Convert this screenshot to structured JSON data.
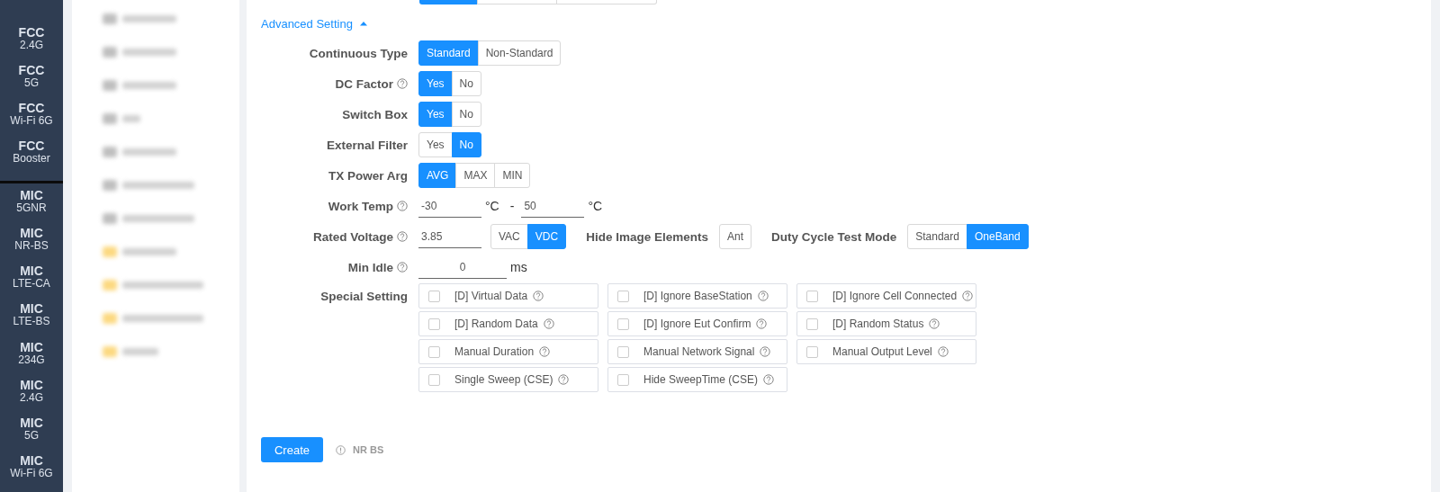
{
  "sidebar": {
    "groups": [
      {
        "items": [
          {
            "label": "FCC",
            "sub": "2.4G"
          },
          {
            "label": "FCC",
            "sub": "5G"
          },
          {
            "label": "FCC",
            "sub": "Wi-Fi 6G"
          },
          {
            "label": "FCC",
            "sub": "Booster"
          }
        ]
      },
      {
        "items": [
          {
            "label": "MIC",
            "sub": "5GNR"
          },
          {
            "label": "MIC",
            "sub": "NR-BS"
          },
          {
            "label": "MIC",
            "sub": "LTE-CA"
          },
          {
            "label": "MIC",
            "sub": "LTE-BS"
          },
          {
            "label": "MIC",
            "sub": "234G"
          },
          {
            "label": "MIC",
            "sub": "2.4G"
          },
          {
            "label": "MIC",
            "sub": "5G"
          },
          {
            "label": "MIC",
            "sub": "Wi-Fi 6G"
          }
        ]
      }
    ]
  },
  "file_list": {
    "items": [
      {
        "kind": "file"
      },
      {
        "kind": "file"
      },
      {
        "kind": "file"
      },
      {
        "kind": "file"
      },
      {
        "kind": "file"
      },
      {
        "kind": "file"
      },
      {
        "kind": "file"
      },
      {
        "kind": "folder"
      },
      {
        "kind": "folder"
      },
      {
        "kind": "folder"
      },
      {
        "kind": "folder"
      }
    ]
  },
  "form": {
    "advanced_toggle": {
      "label": "Advanced Setting",
      "expanded": true
    },
    "rows": [
      {
        "kind": "segmented",
        "label": "Continuous Type",
        "help": false,
        "options": [
          {
            "label": "Standard",
            "selected": true
          },
          {
            "label": "Non-Standard",
            "selected": false
          }
        ]
      },
      {
        "kind": "segmented",
        "label": "DC Factor",
        "help": true,
        "options": [
          {
            "label": "Yes",
            "selected": true
          },
          {
            "label": "No",
            "selected": false
          }
        ]
      },
      {
        "kind": "segmented",
        "label": "Switch Box",
        "help": false,
        "options": [
          {
            "label": "Yes",
            "selected": true
          },
          {
            "label": "No",
            "selected": false
          }
        ]
      },
      {
        "kind": "segmented",
        "label": "External Filter",
        "help": false,
        "options": [
          {
            "label": "Yes",
            "selected": false
          },
          {
            "label": "No",
            "selected": true
          }
        ]
      },
      {
        "kind": "segmented",
        "label": "TX Power Arg",
        "help": false,
        "options": [
          {
            "label": "AVG",
            "selected": true
          },
          {
            "label": "MAX",
            "selected": false
          },
          {
            "label": "MIN",
            "selected": false
          }
        ]
      },
      {
        "kind": "range",
        "label": "Work Temp",
        "help": true,
        "from": "-30",
        "from_unit": "°C",
        "separator": "-",
        "to": "50",
        "to_unit": "°C"
      },
      {
        "kind": "voltage",
        "label": "Rated Voltage",
        "help": true,
        "value": "3.85",
        "options": [
          {
            "label": "VAC",
            "selected": false
          },
          {
            "label": "VDC",
            "selected": true
          }
        ],
        "hide_label": "Hide Image Elements",
        "hide_options": [
          {
            "label": "Ant",
            "selected": false
          }
        ],
        "duty_label": "Duty Cycle Test Mode",
        "duty_options": [
          {
            "label": "Standard",
            "selected": false
          },
          {
            "label": "OneBand",
            "selected": true
          }
        ]
      },
      {
        "kind": "number",
        "label": "Min Idle",
        "help": true,
        "value": "0",
        "unit": "ms"
      }
    ],
    "special": {
      "label": "Special Setting",
      "options": [
        {
          "label": "[D] Virtual Data",
          "checked": false
        },
        {
          "label": "[D] Ignore BaseStation",
          "checked": false
        },
        {
          "label": "[D] Ignore Cell Connected",
          "checked": false
        },
        {
          "label": "[D] Random Data",
          "checked": false
        },
        {
          "label": "[D] Ignore Eut Confirm",
          "checked": false
        },
        {
          "label": "[D] Random Status",
          "checked": false
        },
        {
          "label": "Manual Duration",
          "checked": false
        },
        {
          "label": "Manual Network Signal",
          "checked": false
        },
        {
          "label": "Manual Output Level",
          "checked": false
        },
        {
          "label": "Single Sweep (CSE)",
          "checked": false
        },
        {
          "label": "Hide SweepTime (CSE)",
          "checked": false
        }
      ]
    }
  },
  "footer": {
    "button": "Create",
    "note": "NR BS"
  }
}
